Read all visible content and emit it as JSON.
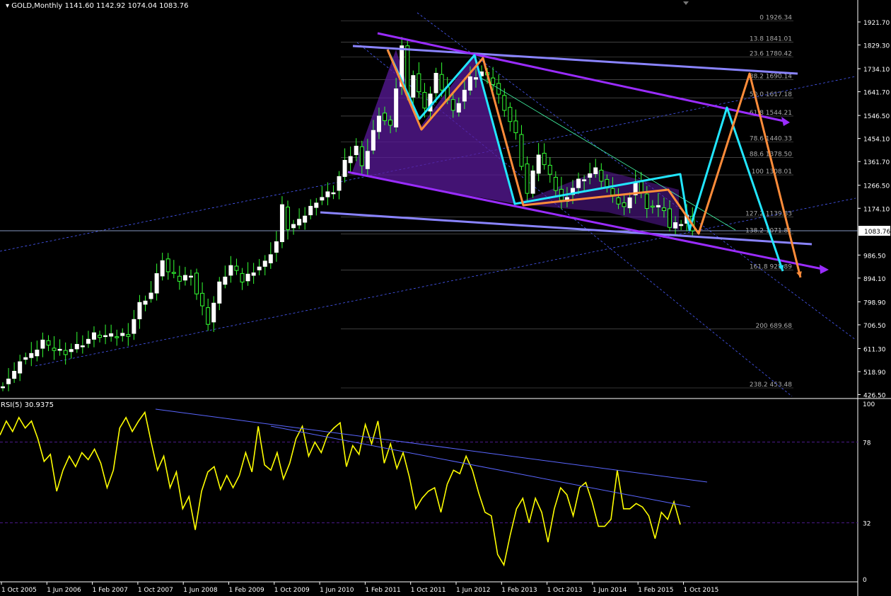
{
  "header": {
    "symbol": "GOLD,Monthly",
    "ohlc": "1141.60 1142.92 1074.04 1083.76"
  },
  "rsi_header": {
    "name": "RSI(5)",
    "value": "30.9375"
  },
  "colors": {
    "background": "#000000",
    "axis_text": "#ffffff",
    "bull_candle": "#ffffff",
    "wick": "#33ff33",
    "fib": "#aaaaaa",
    "purple_channel": "#9a2cff",
    "lavender_channel": "#8a84ff",
    "harmonic_fill": "#5a1a9a",
    "cyan_path": "#22e6ff",
    "orange_path": "#ff8c3a",
    "rsi_line": "#ffff00",
    "rsi_levels": "#4b1a8a",
    "price_tag": "#ffffff"
  },
  "chart_data": [
    {
      "type": "candlestick",
      "title": "GOLD,Monthly",
      "ylim": [
        426.5,
        1960
      ],
      "y_ticks": [
        "1921.70",
        "1829.30",
        "1734.10",
        "1641.70",
        "1546.50",
        "1454.10",
        "1361.70",
        "1266.50",
        "1174.10",
        "1083.76",
        "986.50",
        "894.10",
        "798.90",
        "706.50",
        "611.30",
        "518.90",
        "426.50"
      ],
      "y_tick_values": [
        1921.7,
        1829.3,
        1734.1,
        1641.7,
        1546.5,
        1454.1,
        1361.7,
        1266.5,
        1174.1,
        1083.76,
        986.5,
        894.1,
        798.9,
        706.5,
        611.3,
        518.9,
        426.5
      ],
      "x_ticks": [
        "1 Oct 2005",
        "1 Jun 2006",
        "1 Feb 2007",
        "1 Oct 2007",
        "1 Jun 2008",
        "1 Feb 2009",
        "1 Oct 2009",
        "1 Jun 2010",
        "1 Feb 2011",
        "1 Oct 2011",
        "1 Jun 2012",
        "1 Feb 2013",
        "1 Oct 2013",
        "1 Jun 2014",
        "1 Feb 2015",
        "1 Oct 2015"
      ],
      "close_path": [
        [
          "2005-10",
          470
        ],
        [
          "2005-12",
          513
        ],
        [
          "2006-01",
          568
        ],
        [
          "2006-03",
          582
        ],
        [
          "2006-05",
          643
        ],
        [
          "2006-06",
          613
        ],
        [
          "2006-09",
          599
        ],
        [
          "2006-12",
          632
        ],
        [
          "2007-02",
          665
        ],
        [
          "2007-05",
          659
        ],
        [
          "2007-08",
          672
        ],
        [
          "2007-10",
          789
        ],
        [
          "2007-12",
          834
        ],
        [
          "2008-02",
          971
        ],
        [
          "2008-03",
          917
        ],
        [
          "2008-05",
          886
        ],
        [
          "2008-07",
          914
        ],
        [
          "2008-08",
          833
        ],
        [
          "2008-10",
          718
        ],
        [
          "2008-12",
          869
        ],
        [
          "2009-02",
          942
        ],
        [
          "2009-04",
          883
        ],
        [
          "2009-06",
          927
        ],
        [
          "2009-08",
          955
        ],
        [
          "2009-10",
          1040
        ],
        [
          "2009-11",
          1179
        ],
        [
          "2009-12",
          1096
        ],
        [
          "2010-02",
          1118
        ],
        [
          "2010-05",
          1207
        ],
        [
          "2010-08",
          1246
        ],
        [
          "2010-10",
          1357
        ],
        [
          "2010-12",
          1421
        ],
        [
          "2011-01",
          1333
        ],
        [
          "2011-04",
          1556
        ],
        [
          "2011-06",
          1500
        ],
        [
          "2011-08",
          1826
        ],
        [
          "2011-09",
          1620
        ],
        [
          "2011-10",
          1714
        ],
        [
          "2011-12",
          1564
        ],
        [
          "2012-02",
          1711
        ],
        [
          "2012-05",
          1560
        ],
        [
          "2012-08",
          1692
        ],
        [
          "2012-10",
          1719
        ],
        [
          "2012-12",
          1675
        ],
        [
          "2013-02",
          1579
        ],
        [
          "2013-04",
          1470
        ],
        [
          "2013-06",
          1234
        ],
        [
          "2013-08",
          1395
        ],
        [
          "2013-12",
          1202
        ],
        [
          "2014-03",
          1284
        ],
        [
          "2014-06",
          1327
        ],
        [
          "2014-09",
          1216
        ],
        [
          "2014-11",
          1176
        ],
        [
          "2015-01",
          1280
        ],
        [
          "2015-03",
          1183
        ],
        [
          "2015-06",
          1172
        ],
        [
          "2015-07",
          1095
        ],
        [
          "2015-09",
          1114
        ],
        [
          "2015-10",
          1142
        ],
        [
          "2015-11",
          1083.76
        ]
      ],
      "fibonacci": [
        {
          "label": "0",
          "value": 1926.34
        },
        {
          "label": "13.8",
          "value": 1841.01
        },
        {
          "label": "23.6",
          "value": 1780.42
        },
        {
          "label": "38.2",
          "value": 1690.14
        },
        {
          "label": "50.0",
          "value": 1617.18
        },
        {
          "label": "61.8",
          "value": 1544.21
        },
        {
          "label": "78.6",
          "value": 1440.33
        },
        {
          "label": "88.6",
          "value": 1378.5
        },
        {
          "label": "100",
          "value": 1308.01
        },
        {
          "label": "127.2",
          "value": 1139.83
        },
        {
          "label": "138.2",
          "value": 1071.81
        },
        {
          "label": "161.8",
          "value": 925.89
        },
        {
          "label": "200",
          "value": 689.68
        },
        {
          "label": "238.2",
          "value": 453.48
        }
      ],
      "last_price": "1083.76"
    },
    {
      "type": "line",
      "title": "RSI(5) 30.9375",
      "ylim": [
        0,
        100
      ],
      "y_ticks": [
        "100",
        "78",
        "32",
        "0"
      ],
      "levels": [
        78,
        32
      ],
      "series": [
        {
          "name": "RSI(5)",
          "values": [
            82,
            90,
            84,
            92,
            86,
            90,
            80,
            67,
            71,
            50,
            62,
            70,
            64,
            72,
            68,
            74,
            66,
            52,
            62,
            86,
            92,
            84,
            90,
            95,
            78,
            62,
            70,
            52,
            61,
            40,
            47,
            28,
            50,
            61,
            64,
            51,
            59,
            52,
            59,
            72,
            61,
            87,
            65,
            62,
            72,
            57,
            66,
            80,
            87,
            70,
            78,
            72,
            82,
            86,
            89,
            64,
            76,
            71,
            88,
            77,
            90,
            66,
            77,
            63,
            72,
            58,
            40,
            46,
            50,
            52,
            38,
            54,
            62,
            60,
            70,
            62,
            49,
            38,
            36,
            14,
            8,
            25,
            40,
            46,
            32,
            46,
            38,
            21,
            40,
            52,
            48,
            36,
            52,
            55,
            44,
            30,
            30,
            34,
            62,
            40,
            40,
            43,
            41,
            36,
            23,
            38,
            34,
            44,
            31
          ]
        }
      ]
    }
  ]
}
